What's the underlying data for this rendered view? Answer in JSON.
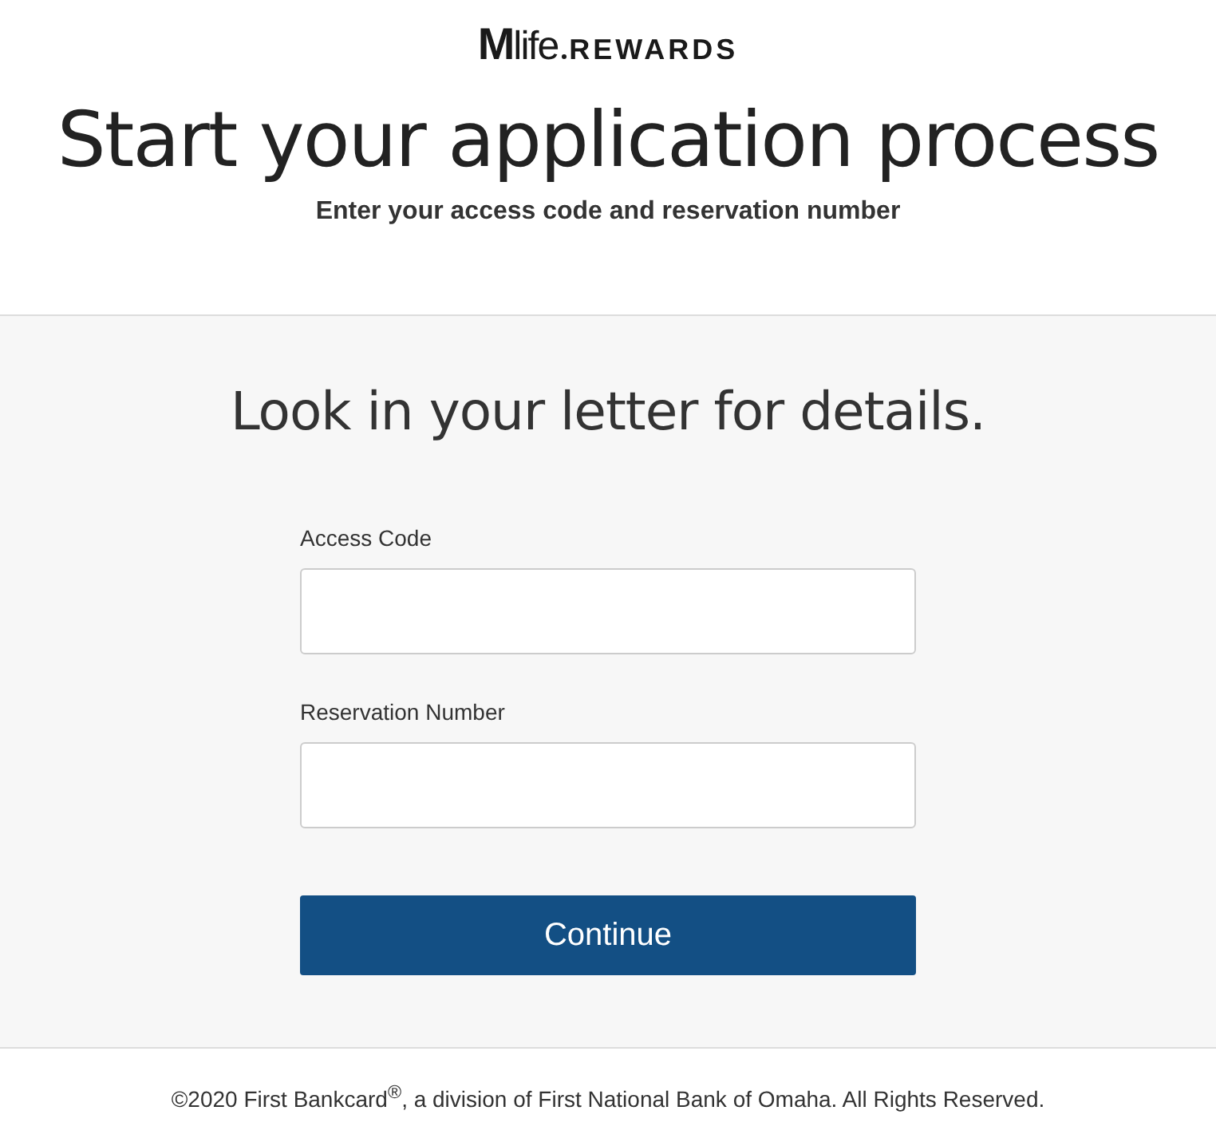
{
  "logo": {
    "mark": "M",
    "script": "life",
    "word": "REWARDS"
  },
  "header": {
    "title": "Start your application process",
    "subtitle": "Enter your access code and reservation number"
  },
  "form": {
    "heading": "Look in your letter for details.",
    "fields": [
      {
        "label": "Access Code"
      },
      {
        "label": "Reservation Number"
      }
    ],
    "button": "Continue"
  },
  "footer": "©2020 First Bankcard$^{®}$, a division of First National Bank of Omaha. All Rights Reserved."
}
